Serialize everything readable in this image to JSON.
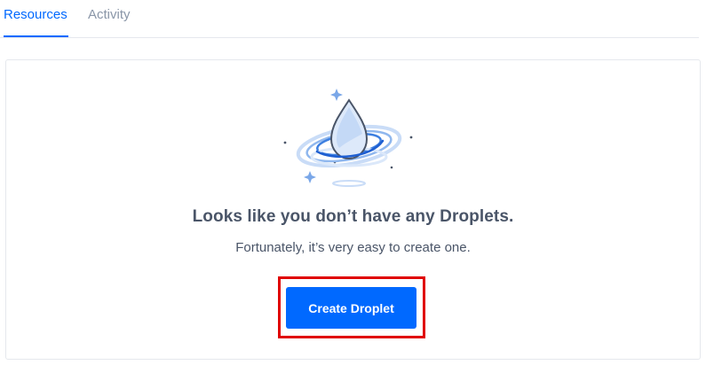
{
  "tabs": [
    {
      "label": "Resources",
      "active": true
    },
    {
      "label": "Activity",
      "active": false
    }
  ],
  "empty_state": {
    "illustration_icon": "droplet-orbit-icon",
    "title": "Looks like you don’t have any Droplets.",
    "subtitle": "Fortunately, it’s very easy to create one.",
    "cta_label": "Create Droplet"
  },
  "colors": {
    "accent": "#0069ff",
    "highlight": "#e00000",
    "text_primary": "#4a5568",
    "tab_inactive": "#8a96a8",
    "border": "#e5e8ed"
  }
}
